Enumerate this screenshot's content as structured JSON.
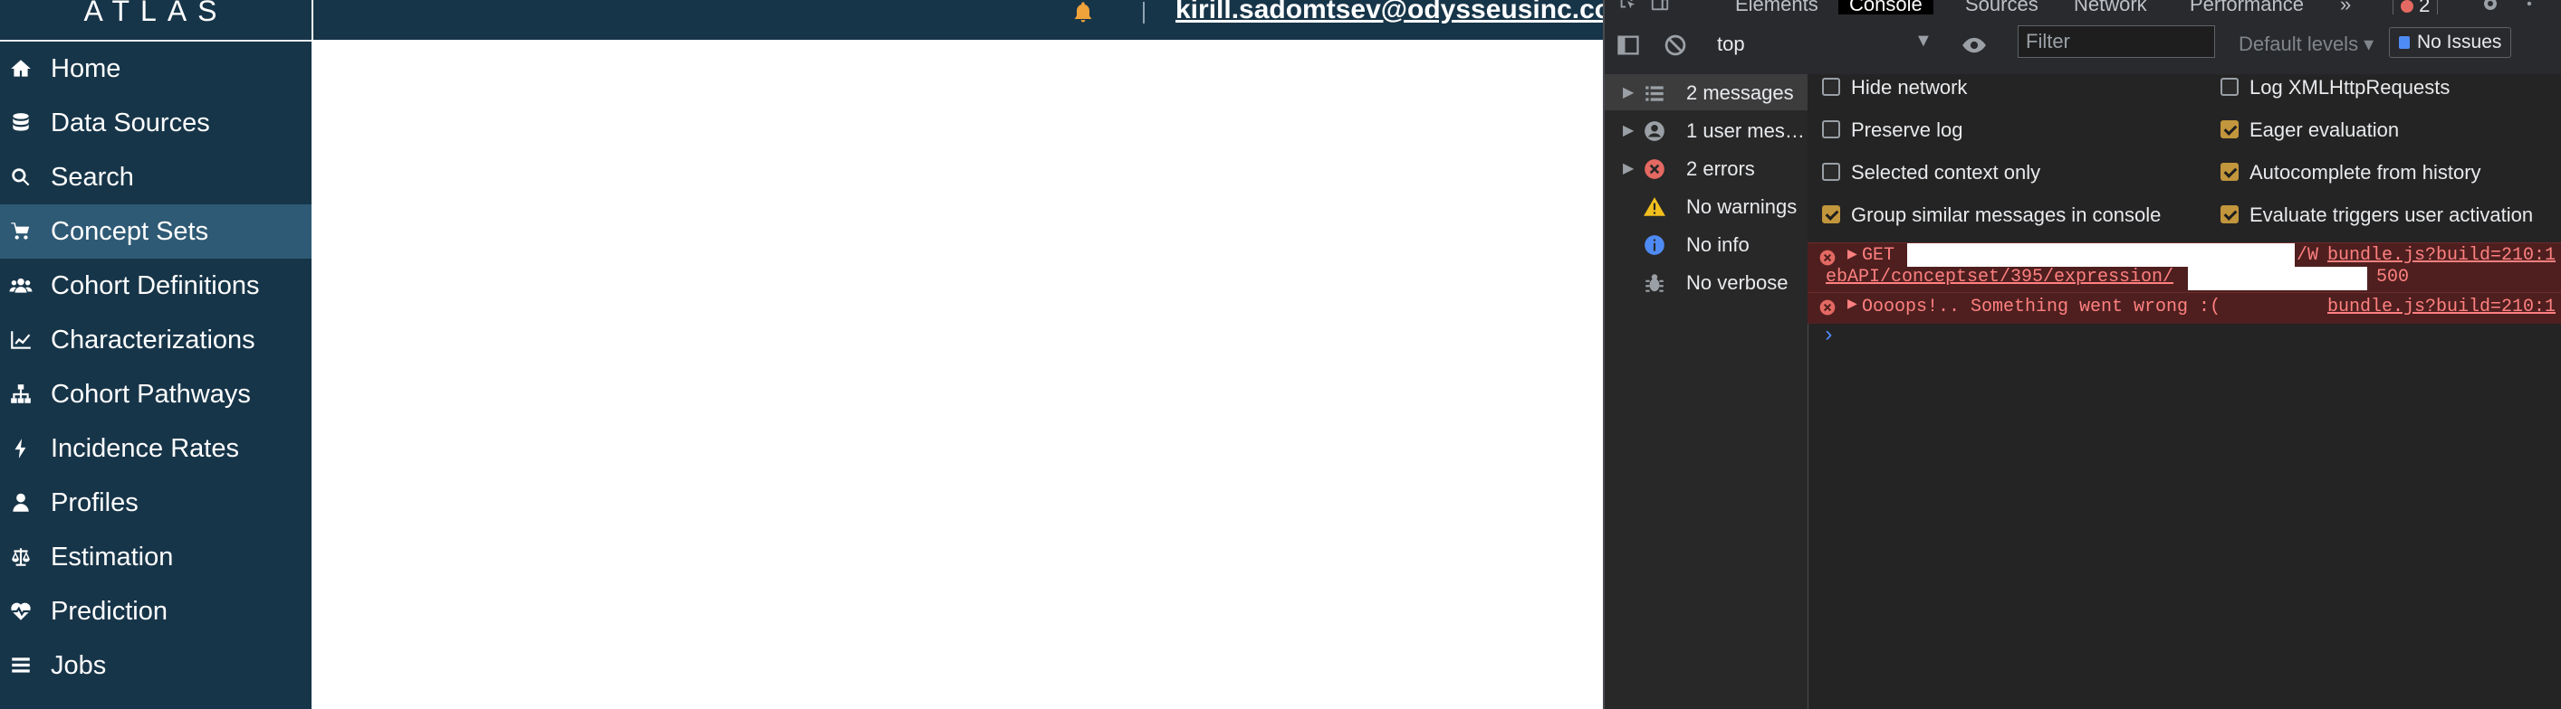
{
  "app": {
    "logo": "ATLAS",
    "user_email": "kirill.sadomtsev@odysseusinc.com"
  },
  "sidebar": {
    "items": [
      {
        "label": "Home",
        "icon": "home-icon",
        "active": false
      },
      {
        "label": "Data Sources",
        "icon": "database-icon",
        "active": false
      },
      {
        "label": "Search",
        "icon": "search-icon",
        "active": false
      },
      {
        "label": "Concept Sets",
        "icon": "shopping-cart-icon",
        "active": true
      },
      {
        "label": "Cohort Definitions",
        "icon": "users-icon",
        "active": false
      },
      {
        "label": "Characterizations",
        "icon": "line-chart-icon",
        "active": false
      },
      {
        "label": "Cohort Pathways",
        "icon": "sitemap-icon",
        "active": false
      },
      {
        "label": "Incidence Rates",
        "icon": "bolt-icon",
        "active": false
      },
      {
        "label": "Profiles",
        "icon": "user-icon",
        "active": false
      },
      {
        "label": "Estimation",
        "icon": "balance-scale-icon",
        "active": false
      },
      {
        "label": "Prediction",
        "icon": "heartbeat-icon",
        "active": false
      },
      {
        "label": "Jobs",
        "icon": "tasks-icon",
        "active": false
      }
    ]
  },
  "devtools": {
    "tabs": {
      "elements": "Elements",
      "console": "Console",
      "sources": "Sources",
      "network": "Network",
      "performance": "Performance",
      "more": "»",
      "error_count": "2"
    },
    "toolbar": {
      "context": "top",
      "filter_placeholder": "Filter",
      "levels": "Default levels ▾",
      "issues": "No Issues"
    },
    "sidebar": {
      "items": [
        {
          "label": "2 messages",
          "icon": "list-icon"
        },
        {
          "label": "1 user mes…",
          "icon": "user-circle-icon"
        },
        {
          "label": "2 errors",
          "icon": "error-icon"
        },
        {
          "label": "No warnings",
          "icon": "warning-icon"
        },
        {
          "label": "No info",
          "icon": "info-icon"
        },
        {
          "label": "No verbose",
          "icon": "bug-icon"
        }
      ]
    },
    "settings": {
      "hide_network": {
        "label": "Hide network",
        "checked": false
      },
      "preserve_log": {
        "label": "Preserve log",
        "checked": false
      },
      "selected_context": {
        "label": "Selected context only",
        "checked": false
      },
      "group_similar": {
        "label": "Group similar messages in console",
        "checked": true
      },
      "log_xhr": {
        "label": "Log XMLHttpRequests",
        "checked": false
      },
      "eager_eval": {
        "label": "Eager evaluation",
        "checked": true
      },
      "autocomplete": {
        "label": "Autocomplete from history",
        "checked": true
      },
      "eval_triggers": {
        "label": "Evaluate triggers user activation",
        "checked": true
      }
    },
    "console": {
      "messages": [
        {
          "line1_prefix": "GET",
          "line1_mid": "/W",
          "source": "bundle.js?build=210:1",
          "line2": "ebAPI/conceptset/395/expression/",
          "status": "500"
        },
        {
          "text": "Oooops!.. Something went wrong :(",
          "source": "bundle.js?build=210:1"
        }
      ],
      "prompt": "›"
    }
  }
}
